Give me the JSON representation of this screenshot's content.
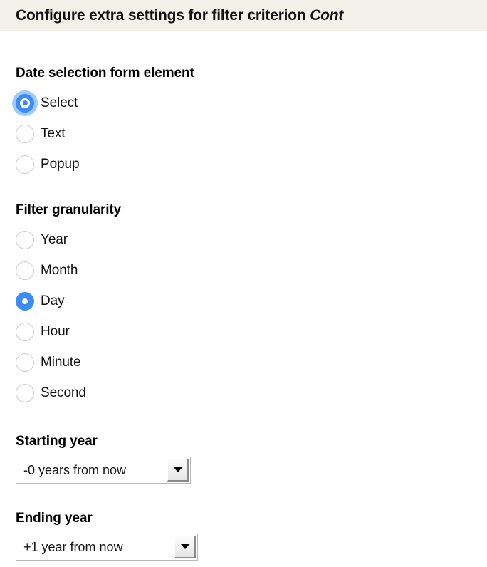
{
  "header": {
    "title_prefix": "Configure extra settings for filter criterion ",
    "criterion": "Cont"
  },
  "colors": {
    "header_bg": "#f1f1ea",
    "header_border": "#c9c9c4",
    "radio_checked": "#3b8cf5",
    "radio_focus_halo": "#9ecbfa",
    "radio_unchecked_border": "#cfcfcf",
    "select_border": "#b8b8b8",
    "text": "#111111"
  },
  "sections": {
    "date_form_element": {
      "heading": "Date selection form element",
      "options": [
        {
          "label": "Select",
          "checked": true,
          "focused": true
        },
        {
          "label": "Text",
          "checked": false,
          "focused": false
        },
        {
          "label": "Popup",
          "checked": false,
          "focused": false
        }
      ]
    },
    "filter_granularity": {
      "heading": "Filter granularity",
      "options": [
        {
          "label": "Year",
          "checked": false,
          "focused": false
        },
        {
          "label": "Month",
          "checked": false,
          "focused": false
        },
        {
          "label": "Day",
          "checked": true,
          "focused": false
        },
        {
          "label": "Hour",
          "checked": false,
          "focused": false
        },
        {
          "label": "Minute",
          "checked": false,
          "focused": false
        },
        {
          "label": "Second",
          "checked": false,
          "focused": false
        }
      ]
    },
    "starting_year": {
      "heading": "Starting year",
      "value": "-0 years from now"
    },
    "ending_year": {
      "heading": "Ending year",
      "value": "+1 year from now"
    }
  }
}
